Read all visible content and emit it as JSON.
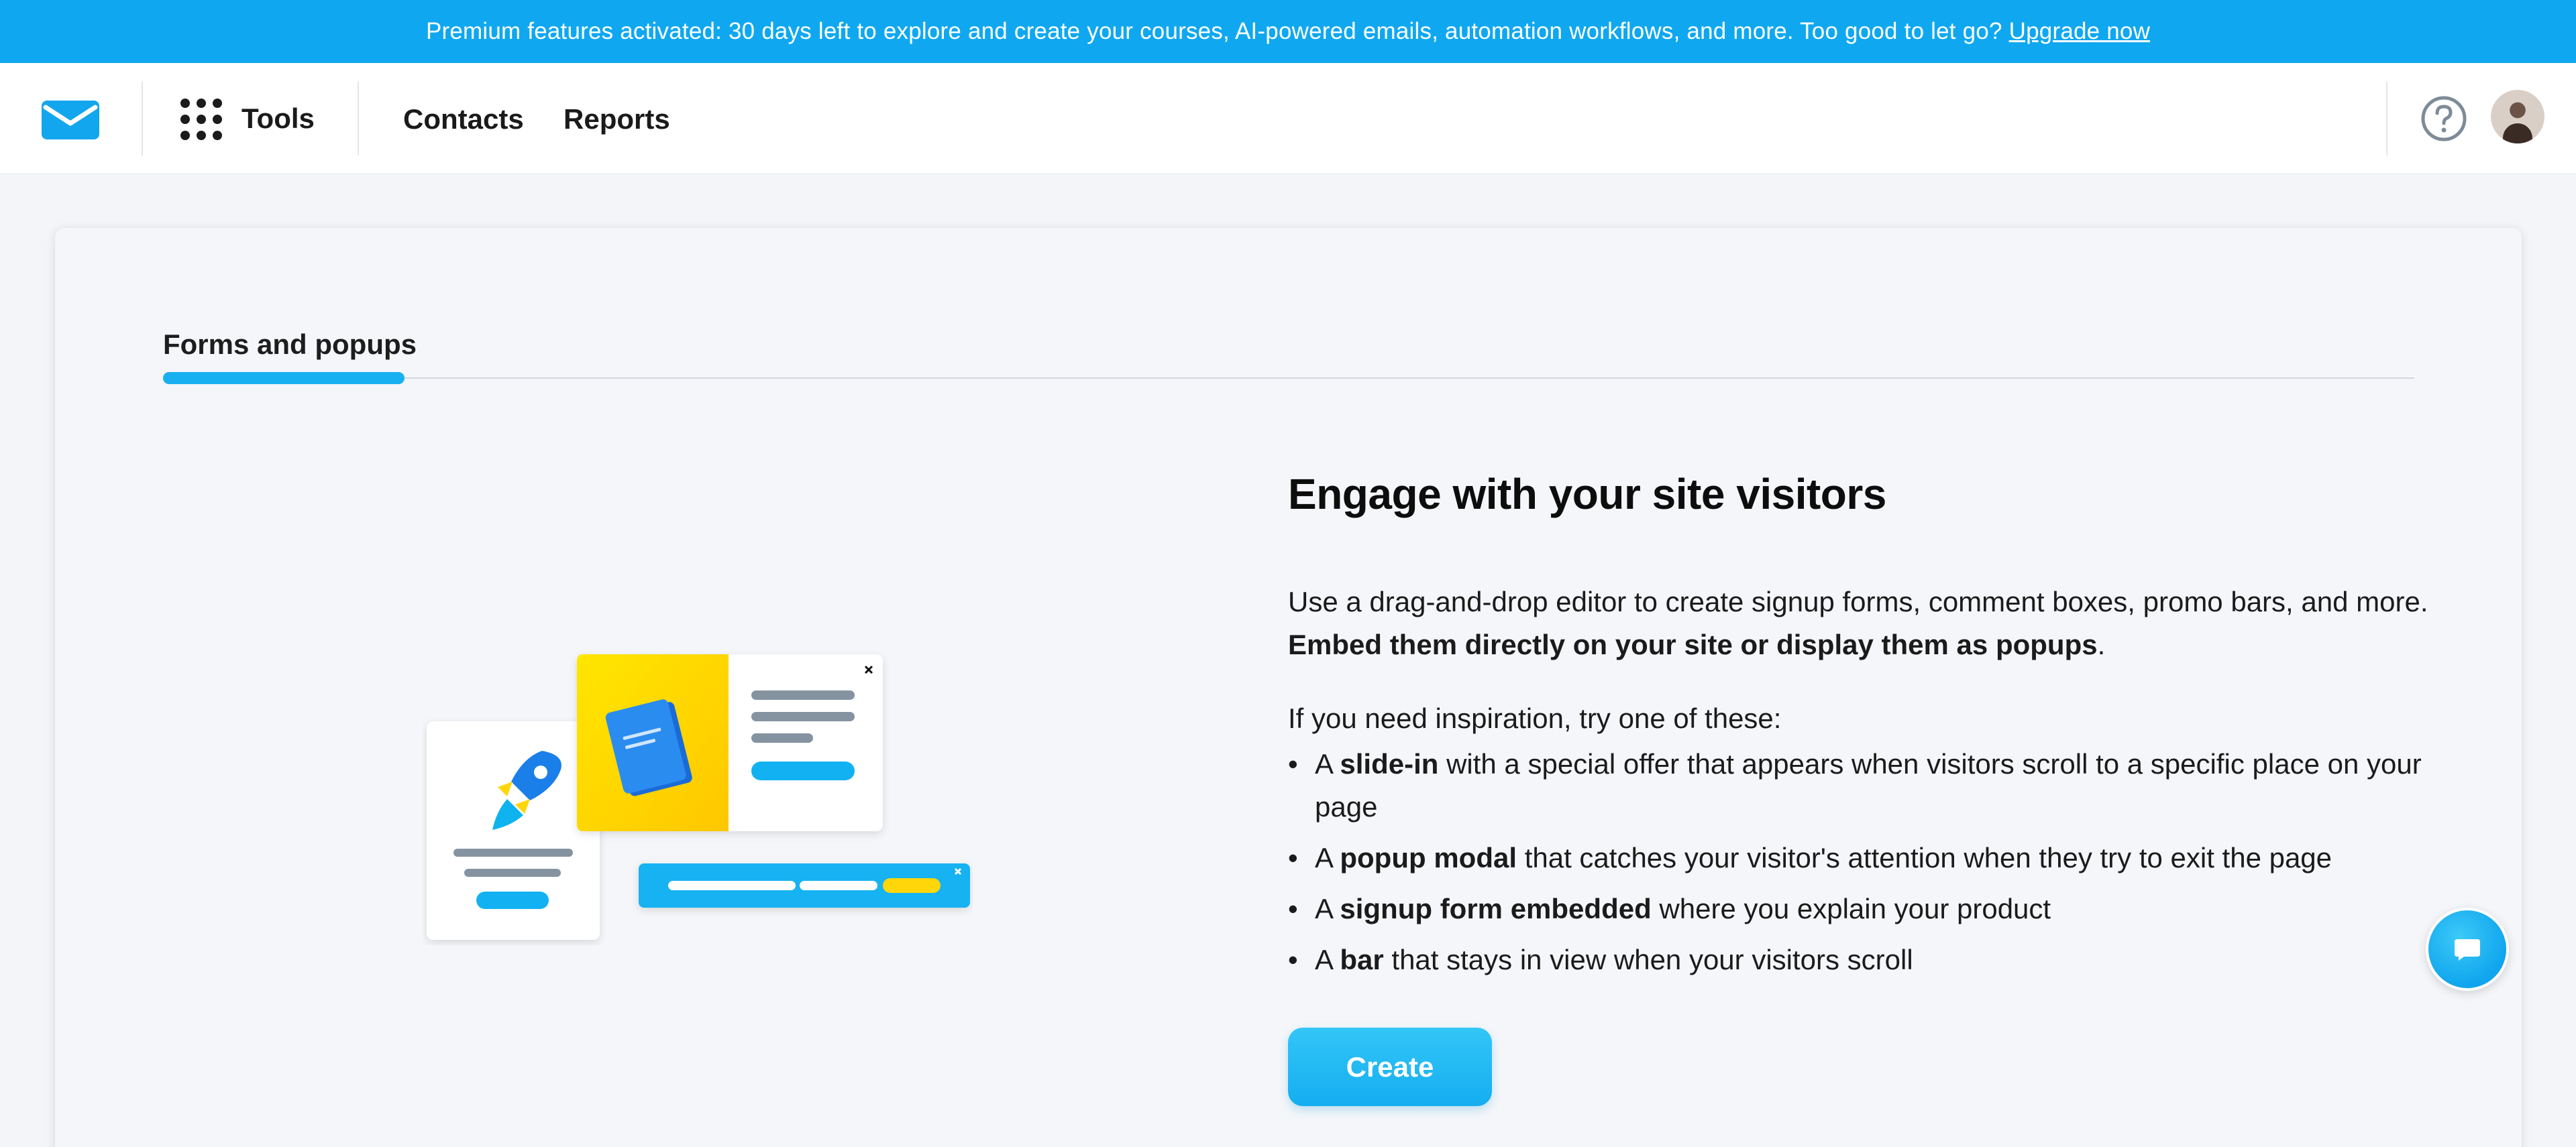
{
  "banner": {
    "text": "Premium features activated: 30 days left to explore and create your courses, AI-powered emails, automation workflows, and more. Too good to let go?",
    "link": "Upgrade now"
  },
  "header": {
    "tools_label": "Tools",
    "nav": [
      "Contacts",
      "Reports"
    ]
  },
  "tabs": [
    {
      "label": "Forms and popups",
      "active": true
    }
  ],
  "content": {
    "heading": "Engage with your site visitors",
    "intro": "Use a drag-and-drop editor to create signup forms, comment boxes, promo bars, and more.",
    "intro_bold": "Embed them directly on your site or display them as popups",
    "intro_end": ".",
    "inspiration": "If you need inspiration, try one of these:",
    "bullets": [
      {
        "pre": "A",
        "bold": "slide-in",
        "rest": "with a special offer that appears when visitors scroll to a specific place on your page"
      },
      {
        "pre": "A",
        "bold": "popup modal",
        "rest": "that catches your visitor's attention when they try to exit the page"
      },
      {
        "pre": "A",
        "bold": "signup form embedded",
        "rest": "where you explain your product"
      },
      {
        "pre": "A",
        "bold": "bar",
        "rest": "that stays in view when your visitors scroll"
      }
    ],
    "create_label": "Create"
  },
  "colors": {
    "brand_blue": "#0fa8f0",
    "accent_yellow": "#ffd60a",
    "text_gray": "#7d8b99"
  }
}
